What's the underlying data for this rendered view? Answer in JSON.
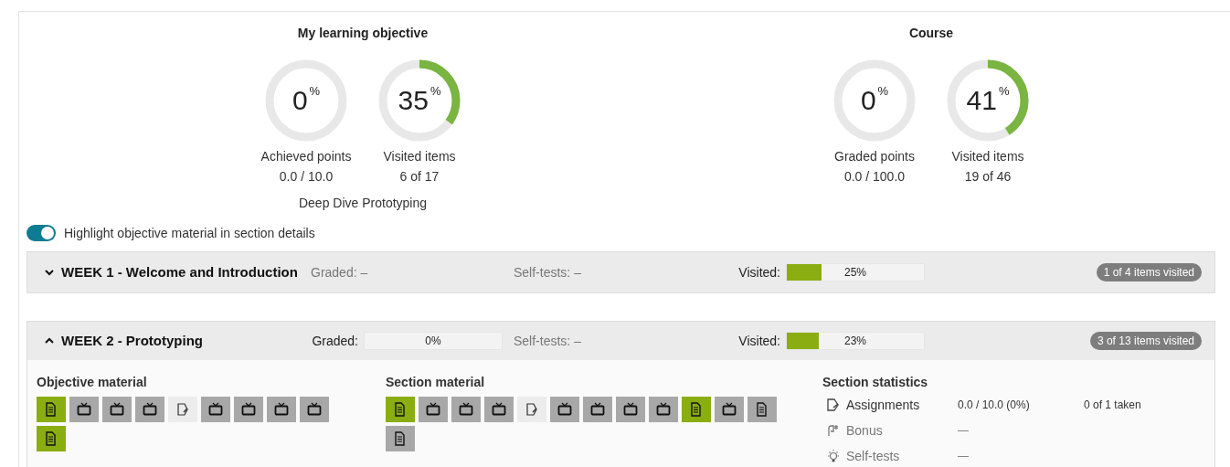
{
  "summaries": [
    {
      "title": "My learning objective",
      "gauges": [
        {
          "value": "0",
          "unit": "%",
          "label": "Achieved points",
          "detail": "0.0 / 10.0"
        },
        {
          "value": "35",
          "unit": "%",
          "level": 0.35,
          "label": "Visited items",
          "detail": "6 of 17"
        }
      ],
      "caption": "Deep Dive Prototyping"
    },
    {
      "title": "Course",
      "gauges": [
        {
          "value": "0",
          "unit": "%",
          "label": "Graded points",
          "detail": "0.0 / 100.0"
        },
        {
          "value": "41",
          "unit": "%",
          "level": 0.41,
          "label": "Visited items",
          "detail": "19 of 46"
        }
      ]
    }
  ],
  "highlight_toggle": {
    "label": "Highlight objective material in section details",
    "on": true
  },
  "sections": [
    {
      "title": "WEEK 1 - Welcome and Introduction",
      "expanded": false,
      "metrics": [
        {
          "kind": "text",
          "label": "Graded:",
          "value": "–"
        },
        {
          "kind": "text",
          "label": "Self-tests:",
          "value": "–"
        },
        {
          "kind": "bar",
          "label": "Visited:",
          "level": 0.25,
          "reading": "25%"
        }
      ],
      "badge": "1 of 4 items visited"
    },
    {
      "title": "WEEK 2 - Prototyping",
      "expanded": true,
      "metrics": [
        {
          "kind": "bar",
          "label": "Graded:",
          "level": 0,
          "reading": "0%"
        },
        {
          "kind": "text",
          "label": "Self-tests:",
          "value": "–"
        },
        {
          "kind": "bar",
          "label": "Visited:",
          "level": 0.23,
          "reading": "23%"
        }
      ],
      "badge": "3 of 13 items visited",
      "objective_material": {
        "title": "Objective material",
        "items": [
          {
            "kind": "text",
            "visited": true
          },
          {
            "kind": "video",
            "visited": false
          },
          {
            "kind": "video",
            "visited": false
          },
          {
            "kind": "video",
            "visited": false
          },
          {
            "kind": "assignment",
            "visited": false
          },
          {
            "kind": "video",
            "visited": false
          },
          {
            "kind": "video",
            "visited": false
          },
          {
            "kind": "video",
            "visited": false
          },
          {
            "kind": "video",
            "visited": false
          },
          {
            "kind": "text",
            "visited": true
          }
        ]
      },
      "section_material": {
        "title": "Section material",
        "items": [
          {
            "kind": "text",
            "visited": true
          },
          {
            "kind": "video",
            "visited": false
          },
          {
            "kind": "video",
            "visited": false
          },
          {
            "kind": "video",
            "visited": false
          },
          {
            "kind": "assignment",
            "visited": false
          },
          {
            "kind": "video",
            "visited": false
          },
          {
            "kind": "video",
            "visited": false
          },
          {
            "kind": "video",
            "visited": false
          },
          {
            "kind": "video",
            "visited": false
          },
          {
            "kind": "text",
            "visited": true
          },
          {
            "kind": "video",
            "visited": false
          },
          {
            "kind": "text",
            "visited": false
          },
          {
            "kind": "text",
            "visited": false
          }
        ]
      },
      "statistics": {
        "title": "Section statistics",
        "rows": [
          {
            "kind": "assignments",
            "label": "Assignments",
            "value": "0.0 / 10.0 (0%)",
            "extra": "0 of 1 taken"
          },
          {
            "kind": "bonus",
            "label": "Bonus",
            "value": "—"
          },
          {
            "kind": "selftests",
            "label": "Self-tests",
            "value": "—"
          }
        ]
      }
    }
  ]
}
